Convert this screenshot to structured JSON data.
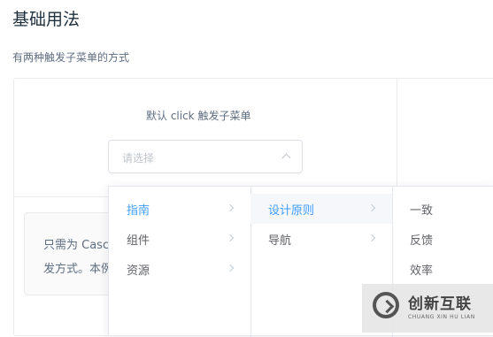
{
  "page": {
    "title": "基础用法",
    "description": "有两种触发子菜单的方式"
  },
  "demo": {
    "label": "默认 click 触发子菜单",
    "select_placeholder": "请选择"
  },
  "code_snippet": {
    "line1": "只需为 Casc",
    "line2": "发方式。本例"
  },
  "cascader": {
    "menu1": [
      "指南",
      "组件",
      "资源"
    ],
    "menu2": [
      "设计原则",
      "导航"
    ],
    "menu3": [
      "一致",
      "反馈",
      "效率"
    ]
  },
  "colors": {
    "active": "#409eff",
    "text": "#606266",
    "placeholder": "#c0c4cc"
  },
  "watermark": {
    "main": "创新互联",
    "sub": "CHUANG XIN HU LIAN"
  }
}
